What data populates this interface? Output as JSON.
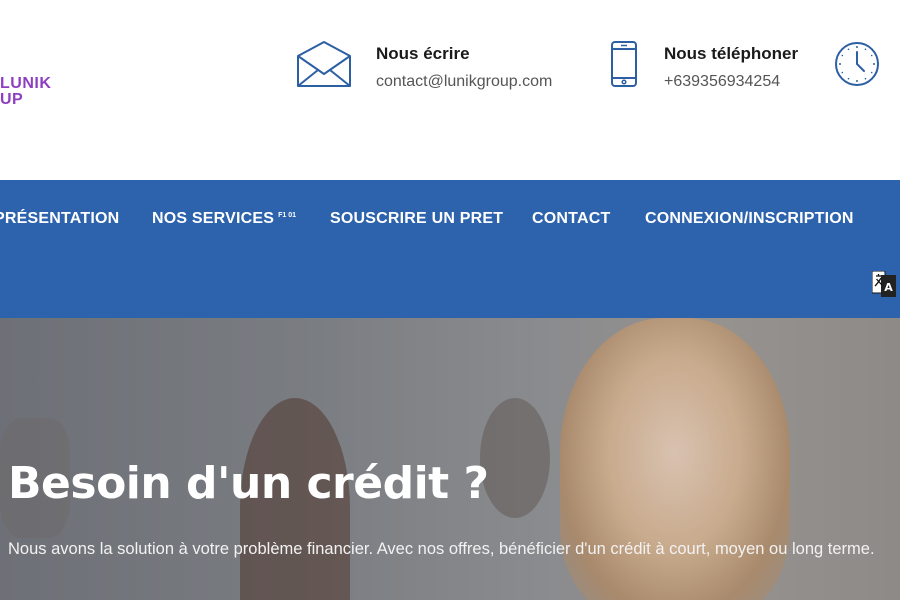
{
  "logo": {
    "line1": "LUNIK",
    "line2": "UP"
  },
  "header": {
    "email": {
      "title": "Nous écrire",
      "value": "contact@lunikgroup.com",
      "icon": "envelope-icon"
    },
    "phone": {
      "title": "Nous téléphoner",
      "value": "+639356934254",
      "icon": "smartphone-icon"
    },
    "hours_icon": "clock-icon"
  },
  "nav": {
    "items": [
      {
        "label": "PRÉSENTATION"
      },
      {
        "label": "NOS SERVICES",
        "suffix": "F1 01"
      },
      {
        "label": "SOUSCRIRE UN PRET"
      },
      {
        "label": "CONTACT"
      },
      {
        "label": "CONNEXION/INSCRIPTION"
      }
    ],
    "translate_icon": "translate-icon"
  },
  "hero": {
    "title": "Besoin d'un crédit ?",
    "text": "Nous avons la solution à votre problème financier. Avec nos offres, bénéficier d'un crédit à court, moyen ou long terme."
  },
  "colors": {
    "nav_bg": "#2d63ad",
    "logo": "#8e3fc1",
    "icon_stroke": "#2d5fa3",
    "white": "#ffffff"
  }
}
